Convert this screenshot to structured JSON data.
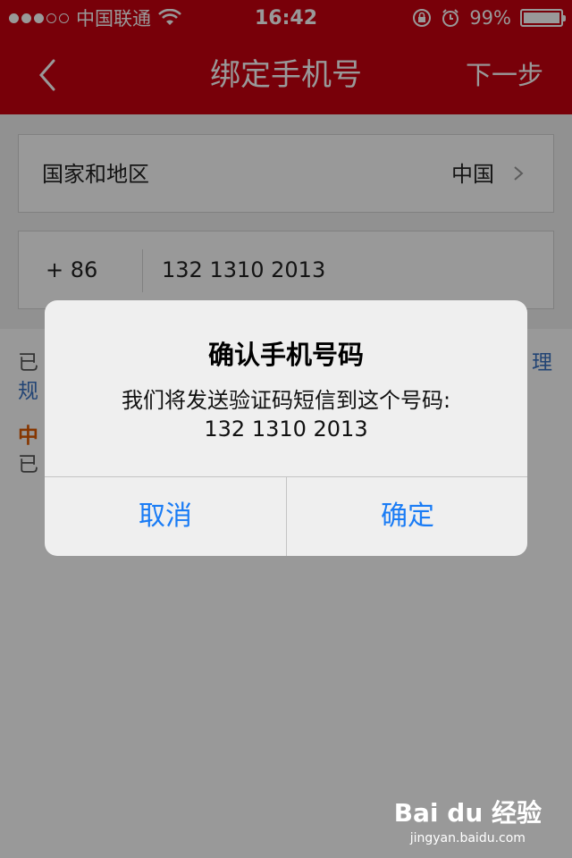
{
  "status_bar": {
    "carrier": "中国联通",
    "time": "16:42",
    "battery": "99%",
    "battery_level": 0.99,
    "signal_bars": 3,
    "signal_total": 5,
    "icons": [
      "signal-dots-icon",
      "wifi-icon",
      "rotation-lock-icon",
      "alarm-icon",
      "battery-icon"
    ]
  },
  "navbar": {
    "title": "绑定手机号",
    "next_label": "下一步",
    "back_icon": "chevron-left-icon"
  },
  "form": {
    "region_label": "国家和地区",
    "region_value": "中国",
    "country_code": "+  86",
    "phone_number": "132 1310 2013"
  },
  "background_text": {
    "notice_visible": "已",
    "notice_link_right": "理",
    "notice_link_left": "规",
    "org_name": "中",
    "org_sub": "已"
  },
  "alert": {
    "title": "确认手机号码",
    "message": "我们将发送验证码短信到这个号码:",
    "phone": "132 1310 2013",
    "cancel_label": "取消",
    "confirm_label": "确定"
  },
  "watermark": {
    "logo": "Bai du 经验",
    "url": "jingyan.baidu.com"
  },
  "colors": {
    "brand_red": "#c8000f",
    "ios_blue": "#1a7cf5",
    "link_blue": "#3b73c4",
    "org_orange": "#e05a00"
  }
}
